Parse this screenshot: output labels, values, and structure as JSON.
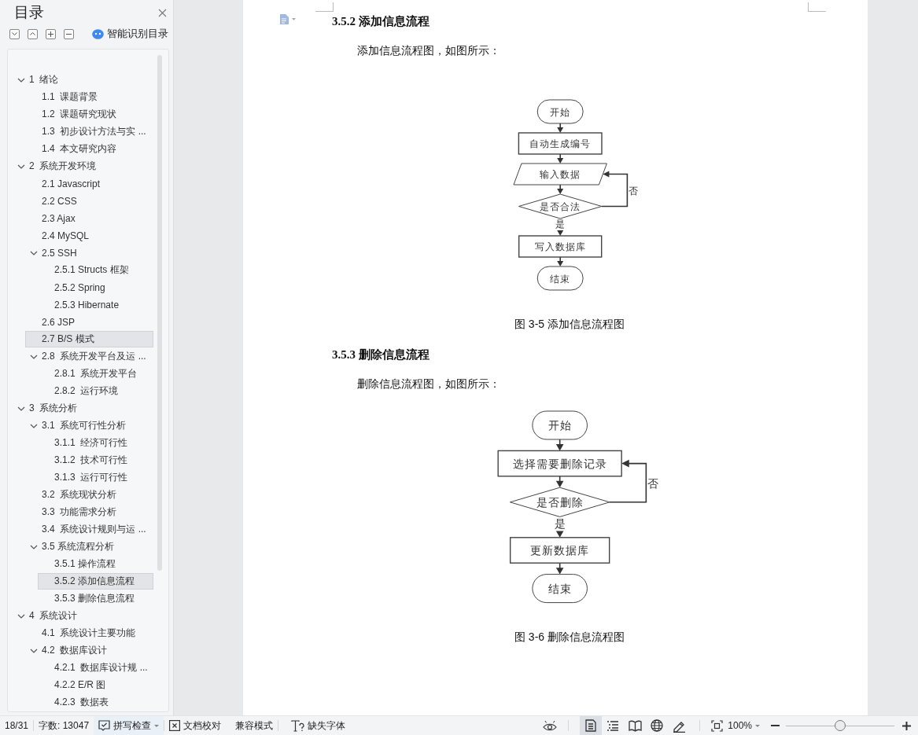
{
  "sidebar": {
    "title": "目录",
    "smart_toc": "智能识别目录",
    "toc": [
      {
        "label": "1  绪论",
        "expanded": true,
        "selected": false,
        "children": [
          {
            "label": "1.1  课题背景",
            "selected": false
          },
          {
            "label": "1.2  课题研究现状",
            "selected": false
          },
          {
            "label": "1.3  初步设计方法与实 ...",
            "selected": false
          },
          {
            "label": "1.4  本文研究内容",
            "selected": false
          }
        ]
      },
      {
        "label": "2  系统开发环境",
        "expanded": true,
        "selected": false,
        "children": [
          {
            "label": "2.1 Javascript",
            "selected": false
          },
          {
            "label": "2.2 CSS",
            "selected": false
          },
          {
            "label": "2.3 Ajax",
            "selected": false
          },
          {
            "label": "2.4 MySQL",
            "selected": false
          },
          {
            "label": "2.5 SSH",
            "expanded": true,
            "selected": false,
            "children": [
              {
                "label": "2.5.1 Structs 框架",
                "selected": false
              },
              {
                "label": "2.5.2 Spring",
                "selected": false
              },
              {
                "label": "2.5.3 Hibernate",
                "selected": false
              }
            ]
          },
          {
            "label": "2.6 JSP",
            "selected": false
          },
          {
            "label": "2.7 B/S 模式",
            "selected": true
          },
          {
            "label": "2.8  系统开发平台及运 ...",
            "expanded": true,
            "selected": false,
            "children": [
              {
                "label": "2.8.1  系统开发平台",
                "selected": false
              },
              {
                "label": "2.8.2  运行环境",
                "selected": false
              }
            ]
          }
        ]
      },
      {
        "label": "3  系统分析",
        "expanded": true,
        "selected": false,
        "children": [
          {
            "label": "3.1  系统可行性分析",
            "expanded": true,
            "selected": false,
            "children": [
              {
                "label": "3.1.1  经济可行性",
                "selected": false
              },
              {
                "label": "3.1.2  技术可行性",
                "selected": false
              },
              {
                "label": "3.1.3  运行可行性",
                "selected": false
              }
            ]
          },
          {
            "label": "3.2  系统现状分析",
            "selected": false
          },
          {
            "label": "3.3  功能需求分析",
            "selected": false
          },
          {
            "label": "3.4  系统设计规则与运 ...",
            "selected": false
          },
          {
            "label": "3.5 系统流程分析",
            "expanded": true,
            "selected": false,
            "children": [
              {
                "label": "3.5.1 操作流程",
                "selected": false
              },
              {
                "label": "3.5.2 添加信息流程",
                "selected": true
              },
              {
                "label": "3.5.3 删除信息流程",
                "selected": false
              }
            ]
          }
        ]
      },
      {
        "label": "4  系统设计",
        "expanded": true,
        "selected": false,
        "children": [
          {
            "label": "4.1  系统设计主要功能",
            "selected": false
          },
          {
            "label": "4.2  数据库设计",
            "expanded": true,
            "selected": false,
            "children": [
              {
                "label": "4.2.1  数据库设计规 ...",
                "selected": false
              },
              {
                "label": "4.2.2 E/R 图",
                "selected": false
              },
              {
                "label": "4.2.3  数据表",
                "selected": false
              }
            ]
          }
        ]
      }
    ]
  },
  "document": {
    "sections": [
      {
        "heading": "3.5.2 添加信息流程",
        "paragraph": "添加信息流程图，如图所示：",
        "flowchart": {
          "nodes": [
            {
              "kind": "terminal",
              "label": "开始"
            },
            {
              "kind": "process",
              "label": "自动生成编号"
            },
            {
              "kind": "io",
              "label": "输入数据"
            },
            {
              "kind": "decision",
              "label": "是否合法"
            },
            {
              "kind": "process",
              "label": "写入数据库"
            },
            {
              "kind": "terminal",
              "label": "结束"
            }
          ],
          "yes_label": "是",
          "loop_label": "否"
        },
        "caption": "图 3-5 添加信息流程图"
      },
      {
        "heading": "3.5.3 删除信息流程",
        "paragraph": "删除信息流程图，如图所示：",
        "flowchart": {
          "nodes": [
            {
              "kind": "terminal",
              "label": "开始"
            },
            {
              "kind": "process",
              "label": "选择需要删除记录"
            },
            {
              "kind": "decision",
              "label": "是否删除"
            },
            {
              "kind": "process",
              "label": "更新数据库"
            },
            {
              "kind": "terminal",
              "label": "结束"
            }
          ],
          "yes_label": "是",
          "loop_label": "否"
        },
        "caption": "图 3-6 删除信息流程图"
      }
    ]
  },
  "status_bar": {
    "page": "18/31",
    "word_count": "字数: 13047",
    "spell_check": "拼写检查",
    "proofread": "文档校对",
    "compat_mode": "兼容模式",
    "missing_fonts": "缺失字体",
    "view_modes": [
      {
        "kind": "page",
        "selected": true
      },
      {
        "kind": "outline",
        "selected": false
      },
      {
        "kind": "reading",
        "selected": false
      },
      {
        "kind": "web",
        "selected": false
      },
      {
        "kind": "write",
        "selected": false
      }
    ],
    "zoom": {
      "value": "100%",
      "level": 0.5
    }
  }
}
